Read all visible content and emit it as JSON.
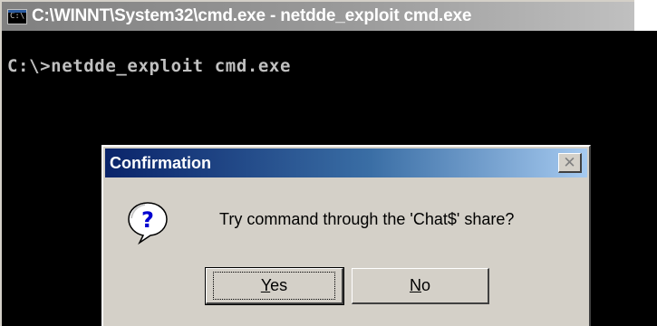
{
  "console": {
    "title": "C:\\WINNT\\System32\\cmd.exe - netdde_exploit cmd.exe",
    "icon_text": "C:\\",
    "prompt_line": "C:\\>netdde_exploit cmd.exe"
  },
  "dialog": {
    "title": "Confirmation",
    "close_symbol": "✕",
    "icon": "question-icon",
    "message": "Try command through the 'Chat$' share?",
    "yes": {
      "mnemonic": "Y",
      "rest": "es"
    },
    "no": {
      "mnemonic": "N",
      "rest": "o"
    }
  },
  "colors": {
    "dialog_title_start": "#0a246a",
    "dialog_title_end": "#a6caf0",
    "face": "#d4d0c8",
    "console_bg": "#000000",
    "console_text": "#c0c0c0"
  }
}
